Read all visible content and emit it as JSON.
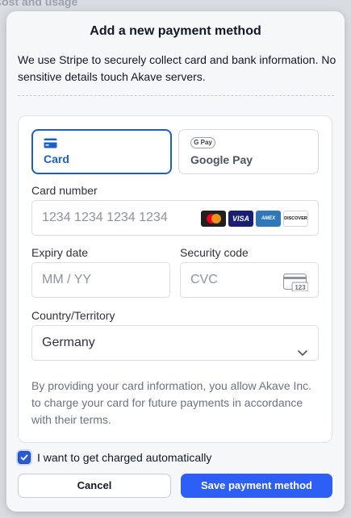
{
  "backdrop": {
    "heading": "Cost and usage"
  },
  "modal": {
    "title": "Add a new payment method",
    "description": "We use Stripe to securely collect card and bank information. No sensitive details touch Akave servers."
  },
  "payment_tabs": [
    {
      "label": "Card",
      "icon": "credit-card-icon",
      "selected": true
    },
    {
      "label": "Google Pay",
      "icon": "google-pay-icon",
      "badge": "G Pay",
      "selected": false
    }
  ],
  "card_number": {
    "label": "Card number",
    "placeholder": "1234 1234 1234 1234",
    "brands": [
      "mastercard",
      "visa",
      "amex",
      "discover"
    ],
    "brand_texts": {
      "visa": "VISA",
      "amex": "AMEX",
      "discover": "DISCOVER"
    }
  },
  "expiry": {
    "label": "Expiry date",
    "placeholder": "MM / YY"
  },
  "security_code": {
    "label": "Security code",
    "placeholder": "CVC",
    "icon_text": "123"
  },
  "country": {
    "label": "Country/Territory",
    "value": "Germany"
  },
  "consent_text": "By providing your card information, you allow Akave Inc. to charge your card for future payments in accordance with their terms.",
  "auto_charge": {
    "label": "I want to get charged automatically",
    "checked": true
  },
  "buttons": {
    "cancel": "Cancel",
    "save": "Save payment method"
  },
  "colors": {
    "accent": "#1a60c6",
    "primary_button": "#2d5ef5"
  }
}
